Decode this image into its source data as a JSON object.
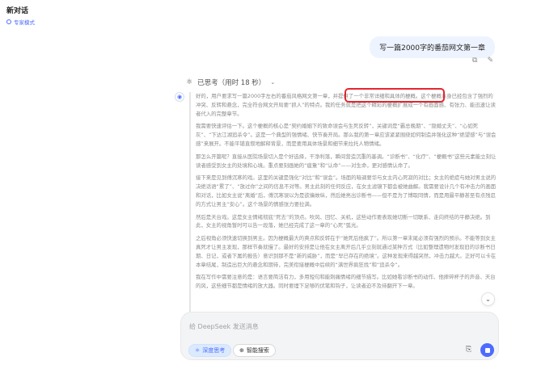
{
  "app": {
    "chat_title": "新对话",
    "mode_label": "专家模式"
  },
  "chat": {
    "user_message": "写一篇2000字的番茄网文第一章",
    "thought_label": "已思考（用时 18 秒）",
    "thinking_paragraphs": [
      "好的，用户要求写一篇2000字左右的番茄风格网文第一章，并提供了一个非常详细和具体的梗概。这个梗概本身已经包含了强烈的冲突、反转和悬念，完全符合网文开局要“抓人”的特点。我的任务就是把这个精彩的梗概扩展成一个有画面感、有张力、能迅速让读者代入的完整章节。",
      "我需要快速评估一下。这个梗概的核心是“契约婚姻下的致命误会与生死反转”，关键词是“霸总晚期”、“隐婚丈夫”、“心如死灰”、“下达江湖追杀令”。这是一个典型的强情绪、快节奏开局。那么我的第一章应该紧紧围绕如何制造并强化这种“绝望感”与“误会感”来展开。不能平铺直叙地解释背景，而是要用具体场景和细节来拉托人物情绪。",
      "那怎么开篇呢？直接从医院场景切入是个好选择，干净利落，瞬间营造沉重的基调。“诊断书”、“化疗”、“梗概书”这些元素能立刻让读者感受到女主的处境和心境。重点要刻画她的“疲惫”和“认命”——对生命，更对感情认命了。",
      "接下来是见到傅沉寒的戏。这里的关键是强化“对比”和“误会”。场面的暗调要华与女主内心死寂的对比；女主的绝症与她对男主说的决绝话语“累了”、“放过你”之间的信息不对等。男主此刻的任何反应，在女主滤镜下都会被她曲解。我需要设计几个有冲击力的画面和对话，比如女主说“离婚”后，傅沉寒误以为是欲擒故纵，然后她亮出诊断书——但不是为了博取同情，而是用最平静甚至有点残忍的方式让男主“安心”。这个场景的情感张力要拉满。",
      "然后是天台戏。这是女主情绪彻底“死去”的顶点。吹风、回忆、关机，这些动作要表现她切断一切联系、走向终结的平静决绝。到此，女主的视角暂时可以告一段落，她已经完成了这一章的“心死”弧光。",
      "之后视角必须快速切换到男主。因为梗概最大的爽点和反转在于“她死后他疯了”。所以第一章末尾必须有强烈的预示。不能等到女主真死才让男主发现，那样节奏就慢了。最好的安排是让他在女主离开后几乎立刻就通过某种方式（比如整理遗物时发现旧的诊断书日期、日记，或者下属的报告）意识到那不是“新的威胁”，而是“早已存在的绝境”。这种发现来得越突然，冲击力越大。正好可以卡在本章结尾，制造出巨大的悬念和期待，完美衔接梗概中后续的“满世界疯狂找”和“追杀令”。",
      "我在写作中需要注意的是：语言要简洁有力，多用短句和能刺痛情绪的细节描写。比如她看诊断书的动作、他摔碎杯子的声音、天台的风，这些细节都是情绪的放大器。同时要埋下足够的伏笔和钩子，让读者迫不及待翻开下一章。"
    ]
  },
  "composer": {
    "placeholder": "给 DeepSeek 发送消息",
    "deep_think_label": "深度思考",
    "web_search_label": "智能搜索"
  },
  "icons": {
    "mode": "expert-icon",
    "copy": "copy-icon",
    "edit": "edit-icon",
    "thought": "thinking-icon",
    "attach": "paperclip-icon",
    "send": "send-stop-icon"
  },
  "colors": {
    "accent": "#4d6bfe",
    "highlight": "#e3262f"
  }
}
